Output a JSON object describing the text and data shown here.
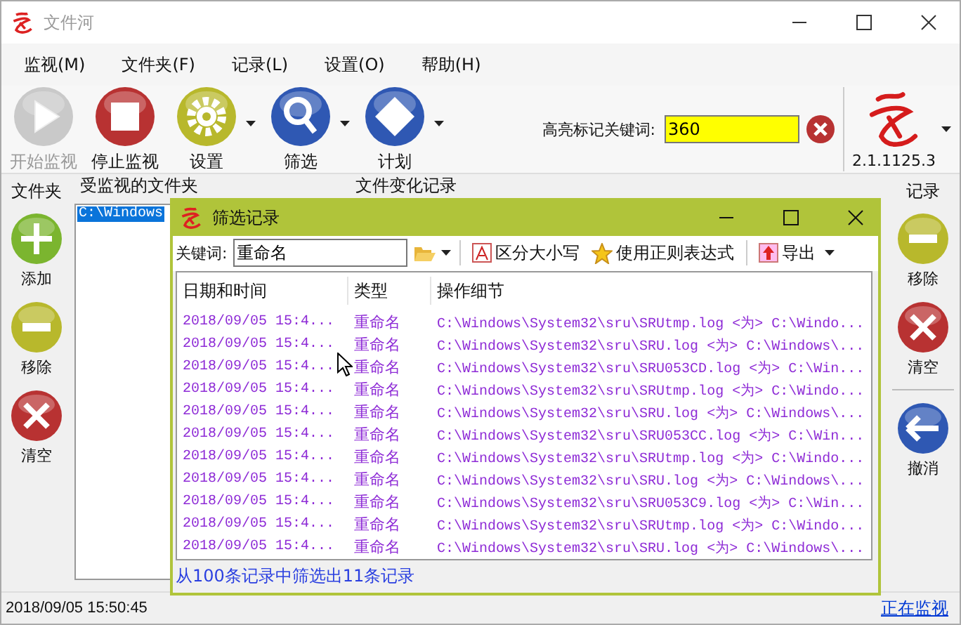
{
  "window": {
    "title": "文件河"
  },
  "menu": [
    "监视(M)",
    "文件夹(F)",
    "记录(L)",
    "设置(O)",
    "帮助(H)"
  ],
  "toolbar": [
    {
      "label": "开始监视",
      "kind": "play",
      "disabled": true,
      "dropdown": false
    },
    {
      "label": "停止监视",
      "kind": "stop",
      "disabled": false,
      "dropdown": false
    },
    {
      "label": "设置",
      "kind": "gear",
      "disabled": false,
      "dropdown": true
    },
    {
      "label": "筛选",
      "kind": "search",
      "disabled": false,
      "dropdown": true
    },
    {
      "label": "计划",
      "kind": "diamond",
      "disabled": false,
      "dropdown": true
    }
  ],
  "highlight": {
    "label": "高亮标记关键词:",
    "value": "360"
  },
  "version": "2.1.1125.3",
  "left_panel": {
    "title": "文件夹",
    "buttons": [
      {
        "label": "添加",
        "kind": "add"
      },
      {
        "label": "移除",
        "kind": "remove"
      },
      {
        "label": "清空",
        "kind": "clear"
      }
    ]
  },
  "folders": {
    "title": "受监视的文件夹",
    "items": [
      {
        "path": "C:\\Windows",
        "selected": true
      }
    ]
  },
  "log": {
    "title": "文件变化记录"
  },
  "right_panel": {
    "title": "记录",
    "buttons": [
      {
        "label": "移除",
        "kind": "remove"
      },
      {
        "label": "清空",
        "kind": "clear"
      },
      {
        "label": "撤消",
        "kind": "undo"
      }
    ]
  },
  "status_bar": {
    "text": "2018/09/05 15:50:45",
    "link": "正在监视"
  },
  "dialog": {
    "title": "筛选记录",
    "keyword_label": "关键词:",
    "keyword_value": "重命名",
    "tools": [
      {
        "label": "区分大小写",
        "kind": "case"
      },
      {
        "label": "使用正则表达式",
        "kind": "star"
      },
      {
        "label": "导出",
        "kind": "export"
      }
    ],
    "columns": [
      "日期和时间",
      "类型",
      "操作细节"
    ],
    "rows": [
      {
        "date": "2018/09/05 15:4...",
        "type": "重命名",
        "detail": "C:\\Windows\\System32\\sru\\SRUtmp.log <为> C:\\Windo..."
      },
      {
        "date": "2018/09/05 15:4...",
        "type": "重命名",
        "detail": "C:\\Windows\\System32\\sru\\SRU.log <为> C:\\Windows\\..."
      },
      {
        "date": "2018/09/05 15:4...",
        "type": "重命名",
        "detail": "C:\\Windows\\System32\\sru\\SRU053CD.log <为> C:\\Win..."
      },
      {
        "date": "2018/09/05 15:4...",
        "type": "重命名",
        "detail": "C:\\Windows\\System32\\sru\\SRUtmp.log <为> C:\\Windo..."
      },
      {
        "date": "2018/09/05 15:4...",
        "type": "重命名",
        "detail": "C:\\Windows\\System32\\sru\\SRU.log <为> C:\\Windows\\..."
      },
      {
        "date": "2018/09/05 15:4...",
        "type": "重命名",
        "detail": "C:\\Windows\\System32\\sru\\SRU053CC.log <为> C:\\Win..."
      },
      {
        "date": "2018/09/05 15:4...",
        "type": "重命名",
        "detail": "C:\\Windows\\System32\\sru\\SRUtmp.log <为> C:\\Windo..."
      },
      {
        "date": "2018/09/05 15:4...",
        "type": "重命名",
        "detail": "C:\\Windows\\System32\\sru\\SRU.log <为> C:\\Windows\\..."
      },
      {
        "date": "2018/09/05 15:4...",
        "type": "重命名",
        "detail": "C:\\Windows\\System32\\sru\\SRU053C9.log <为> C:\\Win..."
      },
      {
        "date": "2018/09/05 15:4...",
        "type": "重命名",
        "detail": "C:\\Windows\\System32\\sru\\SRUtmp.log <为> C:\\Windo..."
      },
      {
        "date": "2018/09/05 15:4...",
        "type": "重命名",
        "detail": "C:\\Windows\\System32\\sru\\SRU.log <为> C:\\Windows\\..."
      }
    ],
    "footer": "从100条记录中筛选出11条记录"
  }
}
